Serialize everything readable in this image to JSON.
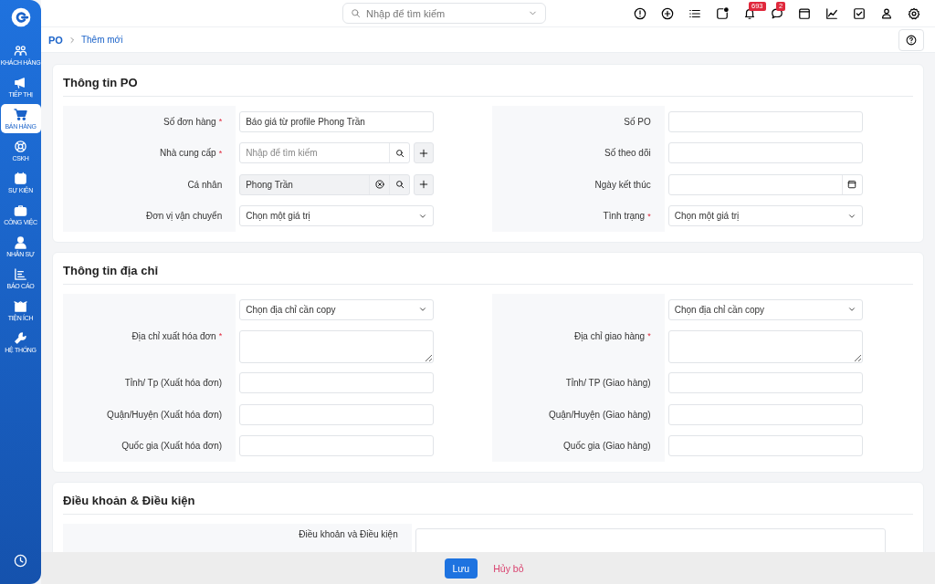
{
  "sidebar": {
    "items": [
      {
        "label": "KHÁCH HÀNG",
        "selected": false
      },
      {
        "label": "TIẾP THỊ",
        "selected": false
      },
      {
        "label": "BÁN HÀNG",
        "selected": true
      },
      {
        "label": "CSKH",
        "selected": false
      },
      {
        "label": "SỰ KIỆN",
        "selected": false
      },
      {
        "label": "CÔNG VIỆC",
        "selected": false
      },
      {
        "label": "NHÂN SỰ",
        "selected": false
      },
      {
        "label": "BÁO CÁO",
        "selected": false
      },
      {
        "label": "TIỆN ÍCH",
        "selected": false
      },
      {
        "label": "HỆ THỐNG",
        "selected": false
      }
    ]
  },
  "topbar": {
    "search": {
      "placeholder": "Nhập để tìm kiếm"
    },
    "notification_count": "693",
    "message_count": "2"
  },
  "breadcrumb": [
    {
      "label": "PO"
    },
    {
      "label": "Thêm mới"
    }
  ],
  "sections": [
    {
      "title": "Thông tin PO",
      "columns": [
        [
          {
            "label": "Số đơn hàng",
            "required_mark": "*",
            "kind": "text",
            "value": "Báo giá từ profile Phong Trần"
          },
          {
            "label": "Nhà cung cấp",
            "required_mark": "*",
            "kind": "lookup",
            "placeholder": "Nhập để tìm kiếm"
          },
          {
            "label": "Cá nhân",
            "kind": "lookup",
            "value": "Phong Trần"
          },
          {
            "label": "Đơn vị vận chuyển",
            "kind": "select",
            "placeholder": "Chọn một giá trị"
          }
        ],
        [
          {
            "label": "Số PO",
            "kind": "text"
          },
          {
            "label": "Số theo dõi",
            "kind": "text"
          },
          {
            "label": "Ngày kết thúc",
            "kind": "date"
          },
          {
            "label": "Tình trạng",
            "required_mark": "*",
            "kind": "select",
            "placeholder": "Chọn một giá trị"
          }
        ]
      ]
    },
    {
      "title": "Thông tin địa chỉ",
      "columns": [
        [
          {
            "kind": "select",
            "placeholder": "Chọn địa chỉ cần copy"
          },
          {
            "label": "Địa chỉ xuất hóa đơn",
            "required_mark": "*",
            "kind": "textarea"
          },
          {
            "label": "Tỉnh/ Tp (Xuất hóa đơn)",
            "kind": "text"
          },
          {
            "label": "Quận/Huyện (Xuất hóa đơn)",
            "kind": "text"
          },
          {
            "label": "Quốc gia (Xuất hóa đơn)",
            "kind": "text"
          }
        ],
        [
          {
            "kind": "select",
            "placeholder": "Chọn địa chỉ cần copy"
          },
          {
            "label": "Địa chỉ giao hàng",
            "required_mark": "*",
            "kind": "textarea"
          },
          {
            "label": "Tỉnh/ TP (Giao hàng)",
            "kind": "text"
          },
          {
            "label": "Quận/Huyện (Giao hàng)",
            "kind": "text"
          },
          {
            "label": "Quốc gia (Giao hàng)",
            "kind": "text"
          }
        ]
      ]
    },
    {
      "title": "Điều khoản & Điều kiện",
      "columns": [
        [
          {
            "label": "Điều khoản và Điều kiện",
            "kind": "textarea"
          }
        ]
      ]
    }
  ],
  "footer": {
    "buttons": [
      {
        "label": "Lưu",
        "kind": "primary"
      },
      {
        "label": "Hủy bỏ",
        "kind": "link"
      }
    ]
  }
}
